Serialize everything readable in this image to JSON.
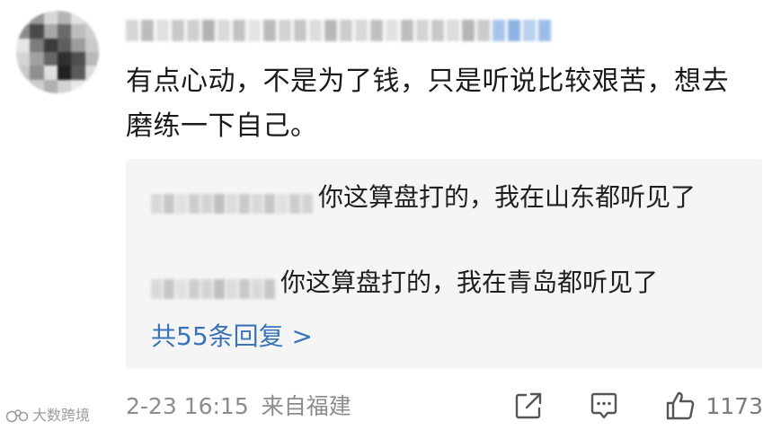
{
  "comment": {
    "text": "有点心动，不是为了钱，只是听说比较艰苦，想去磨练一下自己。"
  },
  "replies": [
    {
      "text": "你这算盘打的，我在山东都听见了"
    },
    {
      "text": "你这算盘打的，我在青岛都听见了"
    }
  ],
  "more_replies_label": "共55条回复 >",
  "footer": {
    "date": "2-23 16:15",
    "location": "来自福建",
    "like_count": "1173"
  },
  "watermark": {
    "text": "大数跨境"
  },
  "colors": {
    "link": "#3a73b8",
    "reply_bg": "#f5f5f5",
    "meta": "#8c8c8c"
  },
  "icons": [
    "share-icon",
    "comment-icon",
    "like-icon"
  ]
}
